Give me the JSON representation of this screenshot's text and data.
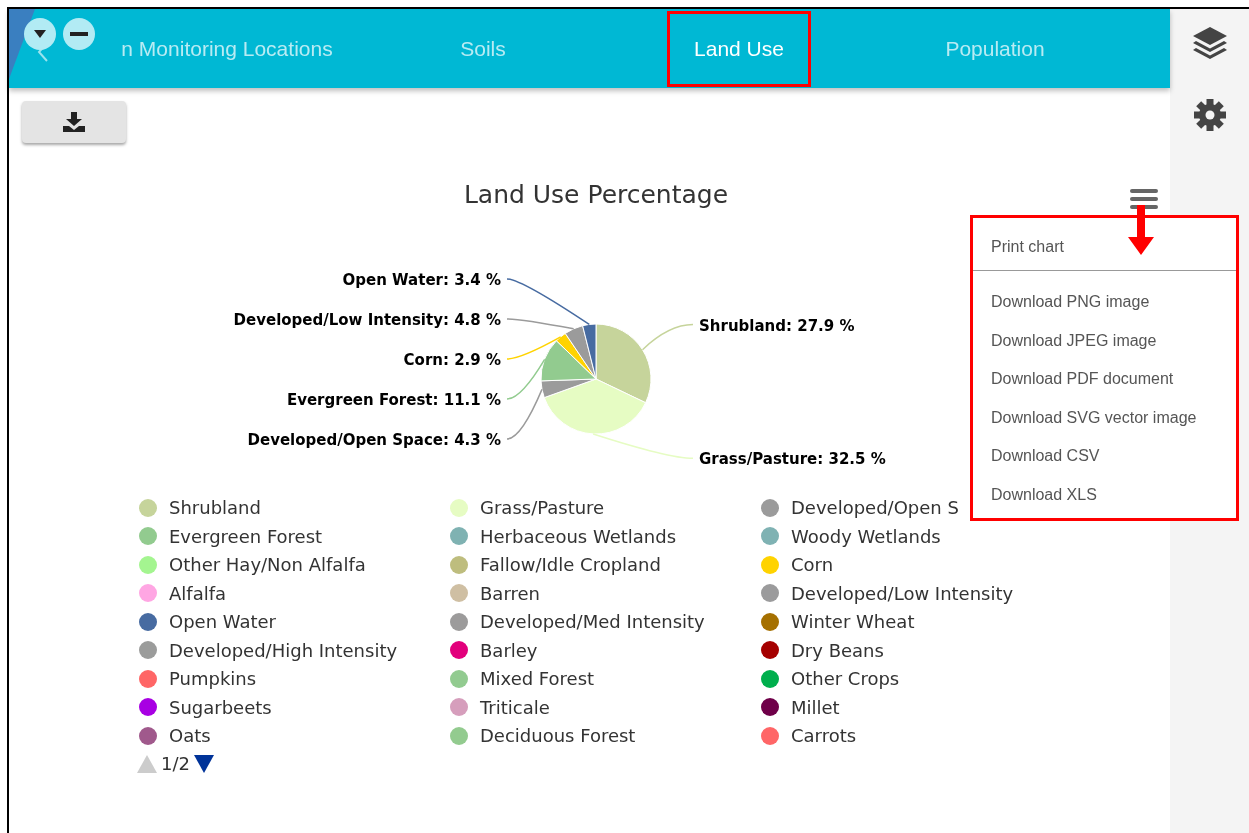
{
  "tabs": [
    {
      "label": "n Monitoring Locations",
      "selected": false,
      "highlighted": false
    },
    {
      "label": "Soils",
      "selected": false,
      "highlighted": false
    },
    {
      "label": "Land Use",
      "selected": true,
      "highlighted": true
    },
    {
      "label": "Population",
      "selected": false,
      "highlighted": false
    }
  ],
  "chart": {
    "chart_data": {
      "type": "pie",
      "title": "Land Use Percentage",
      "data_labels": true,
      "values": [
        27.9,
        32.5,
        4.3,
        11.1,
        2.9,
        4.8,
        3.4
      ],
      "colors": [
        "#c6d49b",
        "#e6fcc3",
        "#9b9b9b",
        "#92cb8f",
        "#ffd300",
        "#9b9b9b",
        "#476ba1"
      ],
      "value_labels": [
        "Shrubland: 27.9 %",
        "Grass/Pasture: 32.5 %",
        "Developed/Open Space: 4.3 %",
        "Evergreen Forest: 11.1 %",
        "Corn: 2.9 %",
        "Developed/Low Intensity: 4.8 %",
        "Open Water: 3.4 %"
      ]
    },
    "legend": [
      {
        "label": "Shrubland",
        "color": "#c6d49b"
      },
      {
        "label": "Grass/Pasture",
        "color": "#e6fcc3"
      },
      {
        "label": "Developed/Open S",
        "color": "#9b9b9b"
      },
      {
        "label": "Evergreen Forest",
        "color": "#92cb8f"
      },
      {
        "label": "Herbaceous Wetlands",
        "color": "#7fb2b2"
      },
      {
        "label": "Woody Wetlands",
        "color": "#7fb2b3"
      },
      {
        "label": "Other Hay/Non Alfalfa",
        "color": "#a4f590"
      },
      {
        "label": "Fallow/Idle Cropland",
        "color": "#bebd7e"
      },
      {
        "label": "Corn",
        "color": "#ffd300"
      },
      {
        "label": "Alfalfa",
        "color": "#ffa6e3"
      },
      {
        "label": "Barren",
        "color": "#cfbfa3"
      },
      {
        "label": "Developed/Low Intensity",
        "color": "#9b9b9c"
      },
      {
        "label": "Open Water",
        "color": "#476ba1"
      },
      {
        "label": "Developed/Med Intensity",
        "color": "#9c9b9b"
      },
      {
        "label": "Winter Wheat",
        "color": "#a57000"
      },
      {
        "label": "Developed/High Intensity",
        "color": "#9b9c9b"
      },
      {
        "label": "Barley",
        "color": "#e2007c"
      },
      {
        "label": "Dry Beans",
        "color": "#a50000"
      },
      {
        "label": "Pumpkins",
        "color": "#ff6666"
      },
      {
        "label": "Mixed Forest",
        "color": "#92cb90"
      },
      {
        "label": "Other Crops",
        "color": "#00af4d"
      },
      {
        "label": "Sugarbeets",
        "color": "#a800e3"
      },
      {
        "label": "Triticale",
        "color": "#d69ebc"
      },
      {
        "label": "Millet",
        "color": "#6f0049"
      },
      {
        "label": "Oats",
        "color": "#a0598c"
      },
      {
        "label": "Deciduous Forest",
        "color": "#93cb8f"
      },
      {
        "label": "Carrots",
        "color": "#ff6667"
      }
    ],
    "pager": {
      "text": "1/2",
      "prev_disabled": true,
      "next_disabled": false
    }
  },
  "export_menu": {
    "highlighted": true,
    "items": [
      {
        "label": "Print chart",
        "kind": "item"
      },
      {
        "kind": "separator"
      },
      {
        "label": "Download PNG image",
        "kind": "item"
      },
      {
        "label": "Download JPEG image",
        "kind": "item"
      },
      {
        "label": "Download PDF document",
        "kind": "item"
      },
      {
        "label": "Download SVG vector image",
        "kind": "item"
      },
      {
        "label": "Download CSV",
        "kind": "item"
      },
      {
        "label": "Download XLS",
        "kind": "item"
      }
    ]
  }
}
